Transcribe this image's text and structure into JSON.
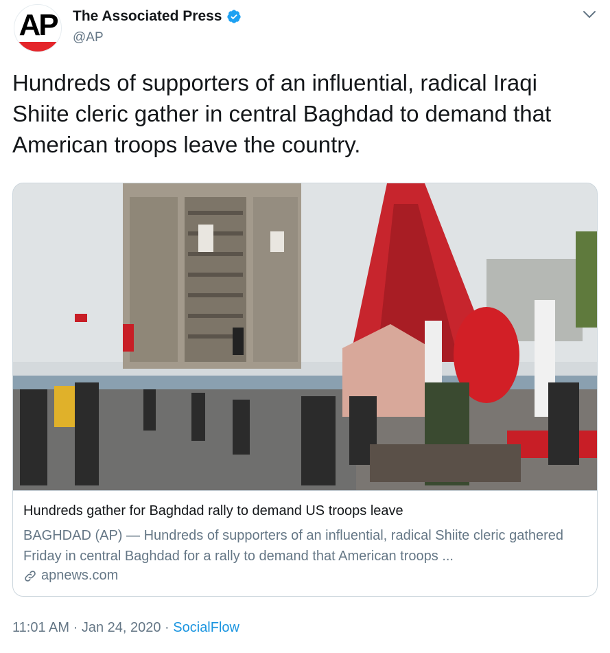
{
  "author": {
    "display_name": "The Associated Press",
    "handle": "@AP",
    "avatar_text": "AP",
    "verified_icon": "verified-badge-icon"
  },
  "tweet": {
    "text": "Hundreds of supporters of an influential, radical Iraqi Shiite cleric gather in central Baghdad to demand that American troops leave the country."
  },
  "card": {
    "title": "Hundreds gather for Baghdad rally to demand US troops leave",
    "description": "BAGHDAD (AP) — Hundreds of supporters of an influential, radical Shiite cleric gathered Friday in central Baghdad for a rally to demand that American troops ...",
    "domain": "apnews.com",
    "link_icon": "link-icon"
  },
  "meta": {
    "time": "11:01 AM",
    "separator": "·",
    "date": "Jan 24, 2020",
    "source": "SocialFlow"
  },
  "colors": {
    "verified": "#1da1f2",
    "link": "#1b95e0",
    "secondary_text": "#657786",
    "ap_red": "#e4252a"
  }
}
